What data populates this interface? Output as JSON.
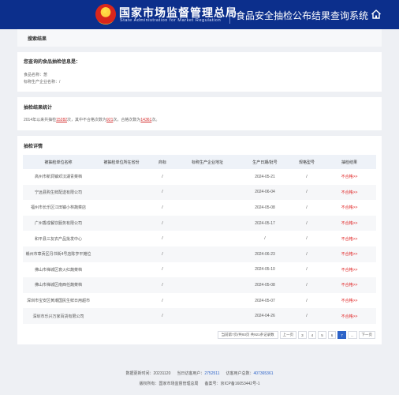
{
  "header": {
    "org_cn": "国家市场监督管理总局",
    "org_en": "State Administration  for  Market Regulation",
    "system_title": "食品安全抽检公布结果查询系统",
    "home_icon": "home-icon"
  },
  "search_bar": {
    "label": "搜索结果"
  },
  "info": {
    "title": "您查询的食品抽检信息是：",
    "food_name": "食品名称：葱",
    "producer": "标称生产企业名称：/"
  },
  "stats": {
    "title": "抽检结果统计",
    "prefix": "2014年以来共抽检",
    "total": "15282",
    "mid1": "次，其中不合格次数为",
    "fail": "921",
    "mid2": "次，合格次数为",
    "pass": "14361",
    "suffix": "次。"
  },
  "detail": {
    "title": "抽检详情",
    "columns": [
      "被抽检单位名称",
      "被抽检单位所在省份",
      "商标",
      "标称生产企业地址",
      "生产日期/批号",
      "规格型号",
      "抽检结果"
    ],
    "rows": [
      [
        "高州市新洞镇邓汉湖青菜档",
        "",
        "/",
        "",
        "2024-05-21",
        "/",
        "不合格>>"
      ],
      [
        "宁远县购生鲜配送有限公司",
        "",
        "/",
        "",
        "2024-06-04",
        "/",
        "不合格>>"
      ],
      [
        "福州市长乐区江田镇小林蔬菜店",
        "",
        "/",
        "",
        "2024-05-08",
        "/",
        "不合格>>"
      ],
      [
        "广州香成餐饮服务有限公司",
        "",
        "/",
        "",
        "2024-05-17",
        "/",
        "不合格>>"
      ],
      [
        "和平县三友农产品批发中心",
        "",
        "/",
        "",
        "/",
        "/",
        "不合格>>"
      ],
      [
        "赣州市章贡区丹书街4号店陈亨平摊位",
        "",
        "/",
        "",
        "2024-06-23",
        "/",
        "不合格>>"
      ],
      [
        "佛山市禅城区衰火红蔬菜档",
        "",
        "/",
        "",
        "2024-05-10",
        "/",
        "不合格>>"
      ],
      [
        "佛山市禅城区南西任蔬菜档",
        "",
        "/",
        "",
        "2024-05-08",
        "/",
        "不合格>>"
      ],
      [
        "深圳市宝安区黄潮国民生鲜日用超市",
        "",
        "/",
        "",
        "2024-05-07",
        "/",
        "不合格>>"
      ],
      [
        "深圳市乐兴万家百货有限公司",
        "",
        "/",
        "",
        "2024-04-26",
        "/",
        "不合格>>"
      ]
    ]
  },
  "pager": {
    "info": "当前第7页/共93页 共921条记录数",
    "prev": "上一页",
    "pages": [
      "3",
      "4",
      "5",
      "6",
      "7",
      "..."
    ],
    "active": "7",
    "next": "下一页"
  },
  "footer": {
    "update_label": "数据更新时间：",
    "update_value": "20231120",
    "today_label": "当日访客用户：",
    "today_value": "2752511",
    "total_label": "访客用户总数：",
    "total_value": "407365361",
    "copyright": "版权所有：国家市场监督管理总局",
    "icp": "备案号：京ICP备16053442号-1"
  }
}
